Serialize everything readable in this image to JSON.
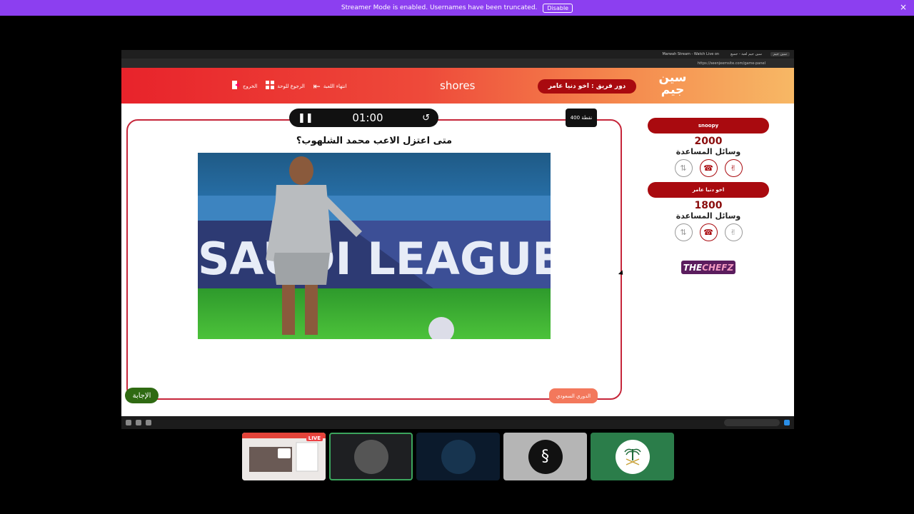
{
  "streamer_mode": {
    "message": "Streamer Mode is enabled. Usernames have been truncated.",
    "disable_label": "Disable",
    "close_glyph": "×"
  },
  "browser": {
    "tabs": [
      "سين جيم لعبة - جميع",
      "سين جيم",
      "Marwah Stream - Watch Live on"
    ],
    "url": "https://seenjeemsite.com/game-panel"
  },
  "header": {
    "logo_text": "سين جيم",
    "turn_label": "دور فريق : اخو دنيا عامر",
    "game_name": "shores",
    "nav": [
      {
        "label": "انتهاء اللعبة",
        "icon": "arrow-left-icon"
      },
      {
        "label": "الرجوع للوحة",
        "icon": "grid-icon"
      },
      {
        "label": "الخروج",
        "icon": "exit-icon"
      }
    ]
  },
  "question_card": {
    "timer": "01:00",
    "points": "400 نقطة",
    "question": "متى اعتزل الاعب محمد الشلهوب؟",
    "image_banner_text": "SAUDI LEAGUE",
    "answer_label": "الإجابة",
    "category": "الدوري السعودي"
  },
  "teams": [
    {
      "name": "snoopy",
      "score": "2000",
      "lifelines_label": "وسائل المساعدة"
    },
    {
      "name": "اخو دنيا عامر",
      "score": "1800",
      "lifelines_label": "وسائل المساعدة"
    }
  ],
  "sponsor": {
    "part1": "THE",
    "part2": "CHEFZ"
  },
  "participants": {
    "live_label": "LIVE"
  },
  "colors": {
    "header_start": "#e8232b",
    "header_end": "#f7b865",
    "team_red": "#a90a0f",
    "answer_green": "#2f6a12",
    "category_orange": "#f3785c",
    "streamer_purple": "#8c3ff0"
  }
}
